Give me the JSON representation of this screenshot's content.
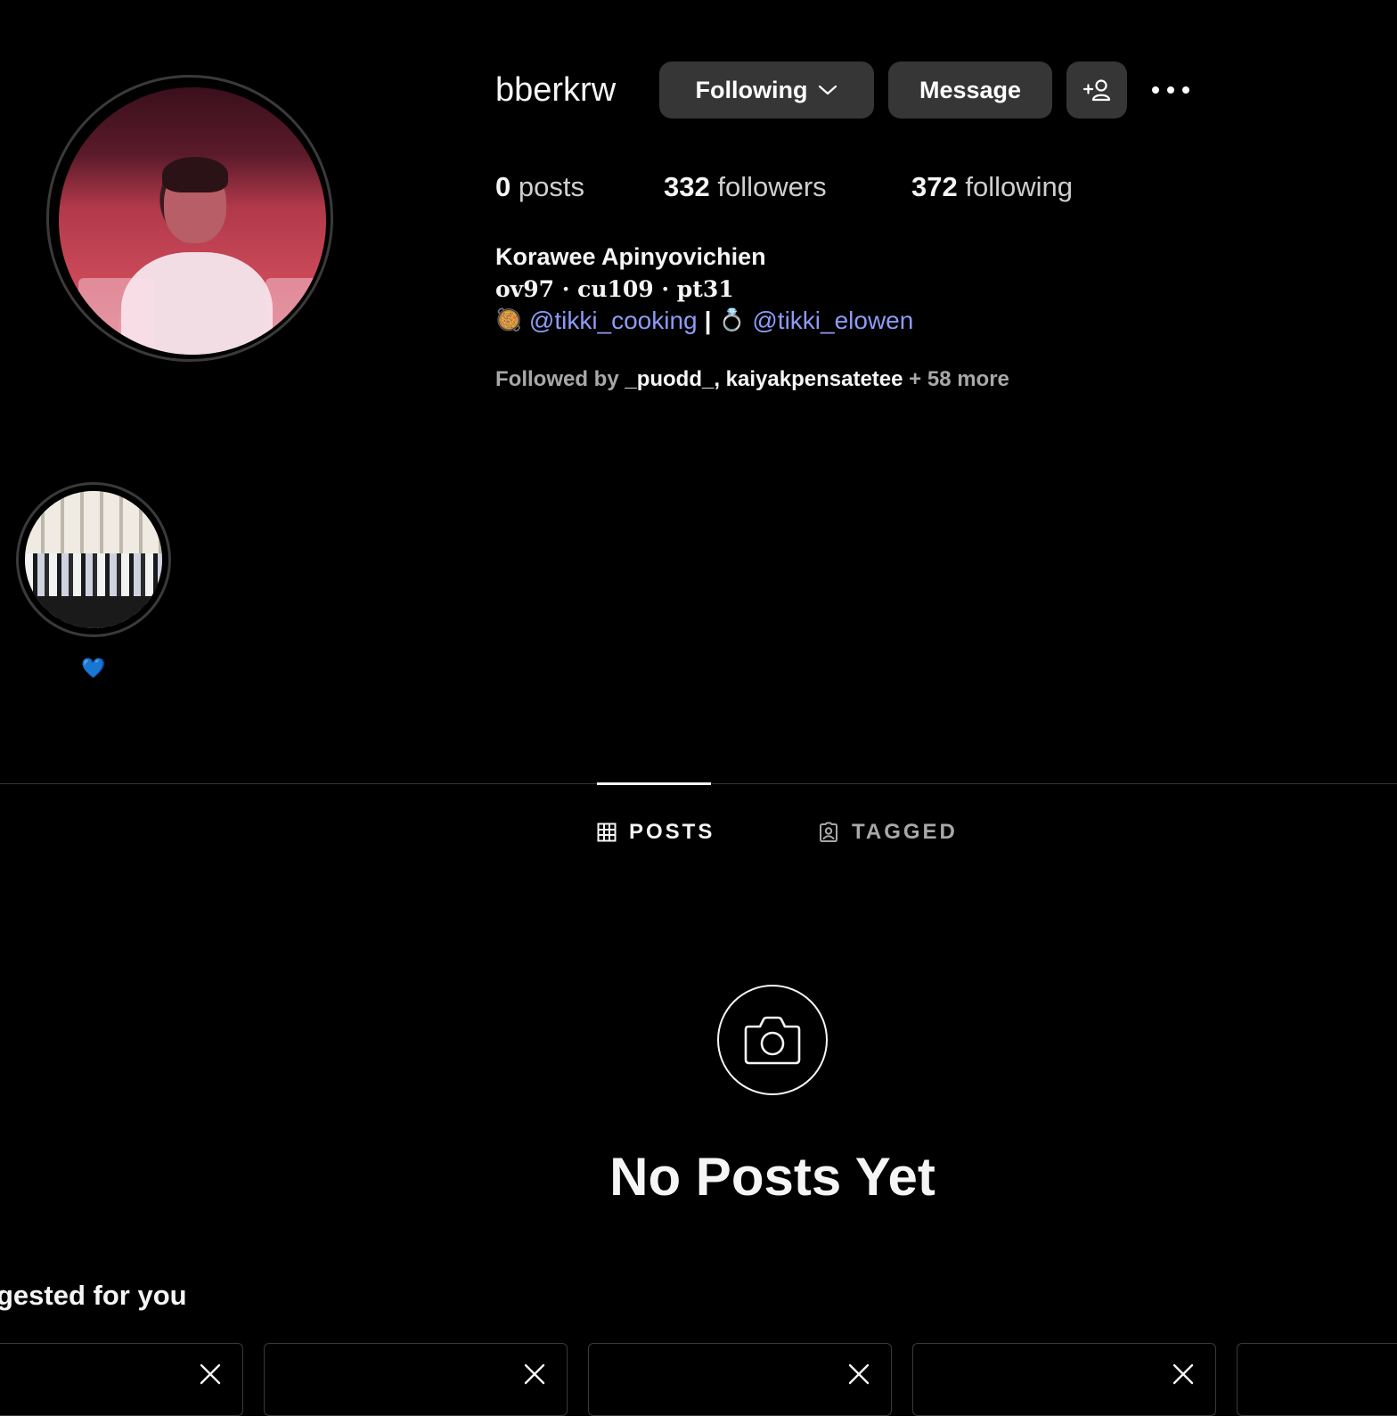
{
  "profile": {
    "username": "bberkrw",
    "full_name": "Korawee Apinyovichien",
    "bio_line": "ov97 · cu109 · pt31",
    "bio_links": [
      {
        "emoji": "🥘",
        "handle": "@tikki_cooking"
      },
      {
        "separator": "|"
      },
      {
        "emoji": "💍",
        "handle": "@tikki_elowen"
      }
    ],
    "followed_by_prefix": "Followed by",
    "followed_by_names": "_puodd_, kaiyakpensatetee",
    "followed_by_more": "+ 58 more"
  },
  "actions": {
    "following_label": "Following",
    "message_label": "Message",
    "add_person_icon": "add-person-icon",
    "more_icon": "more-options-icon"
  },
  "stats": {
    "posts_count": "0",
    "posts_label": "posts",
    "followers_count": "332",
    "followers_label": "followers",
    "following_count": "372",
    "following_label": "following"
  },
  "highlights": [
    {
      "label": "💙"
    }
  ],
  "tabs": [
    {
      "label": "POSTS",
      "icon": "grid-icon",
      "active": true
    },
    {
      "label": "TAGGED",
      "icon": "tagged-icon",
      "active": false
    }
  ],
  "empty_state": {
    "icon": "camera-icon",
    "title": "No Posts Yet"
  },
  "suggested": {
    "title": "gested for you"
  }
}
